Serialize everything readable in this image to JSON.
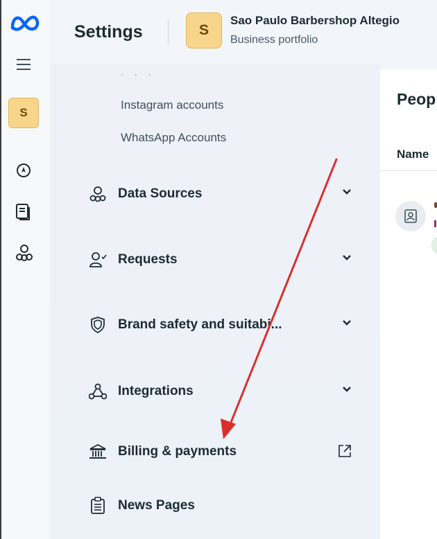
{
  "header": {
    "title": "Settings",
    "business_initial": "S",
    "business_name": "Sao Paulo Barbershop Altegio",
    "business_subtitle": "Business portfolio"
  },
  "rail": {
    "avatar_initial": "S",
    "icons": [
      "meta-logo-icon",
      "menu-icon",
      "compass-icon",
      "pages-icon",
      "people-group-icon"
    ]
  },
  "nav": {
    "truncated_above": ". . .",
    "sub_items": [
      "Instagram accounts",
      "WhatsApp Accounts"
    ],
    "items": [
      {
        "label": "Data Sources",
        "icon": "data-sources-icon",
        "trailing": "chevron"
      },
      {
        "label": "Requests",
        "icon": "requests-icon",
        "trailing": "chevron"
      },
      {
        "label": "Brand safety and suitabi...",
        "icon": "shield-icon",
        "trailing": "chevron"
      },
      {
        "label": "Integrations",
        "icon": "integrations-icon",
        "trailing": "chevron"
      },
      {
        "label": "Billing & payments",
        "icon": "bank-icon",
        "trailing": "external"
      },
      {
        "label": "News Pages",
        "icon": "clipboard-icon",
        "trailing": "none"
      }
    ]
  },
  "panel": {
    "title": "Peop",
    "column_header": "Name"
  },
  "colors": {
    "accent_avatar": "#f7d58a",
    "arrow": "#d9302c",
    "meta_blue": "#0866ff"
  }
}
